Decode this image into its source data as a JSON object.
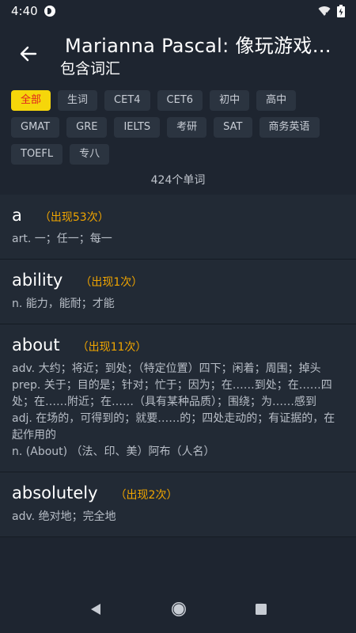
{
  "status": {
    "time": "4:40"
  },
  "header": {
    "title": "Marianna Pascal: 像玩游戏…",
    "subtitle": "包含词汇"
  },
  "filters": [
    "全部",
    "生词",
    "CET4",
    "CET6",
    "初中",
    "高中",
    "GMAT",
    "GRE",
    "IELTS",
    "考研",
    "SAT",
    "商务英语",
    "TOEFL",
    "专八"
  ],
  "active_filter": "全部",
  "word_count_text": "424个单词",
  "words": [
    {
      "word": "a",
      "count": "（出现53次）",
      "definition": "art. 一；任一；每一"
    },
    {
      "word": "ability",
      "count": "（出现1次）",
      "definition": "n. 能力，能耐；才能"
    },
    {
      "word": "about",
      "count": "（出现11次）",
      "definition": "adv. 大约；将近；到处；（特定位置）四下；闲着；周围；掉头\nprep. 关于；目的是；针对；忙于；因为；在……到处；在……四处；在……附近；在……（具有某种品质）；围绕；为……感到\nadj. 在场的，可得到的；就要……的；四处走动的；有证据的，在起作用的\nn. (About) （法、印、美）阿布（人名）"
    },
    {
      "word": "absolutely",
      "count": "（出现2次）",
      "definition": "adv. 绝对地；完全地"
    }
  ],
  "colors": {
    "accent_chip_bg": "#f6d60a",
    "accent_chip_text": "#e02020",
    "count_tag": "#f0a500"
  },
  "icons": {
    "back": "arrow-left-icon",
    "wifi": "wifi-icon",
    "battery": "battery-icon",
    "nav_back": "triangle-back-icon",
    "nav_home": "circle-home-icon",
    "nav_recent": "square-recent-icon"
  }
}
